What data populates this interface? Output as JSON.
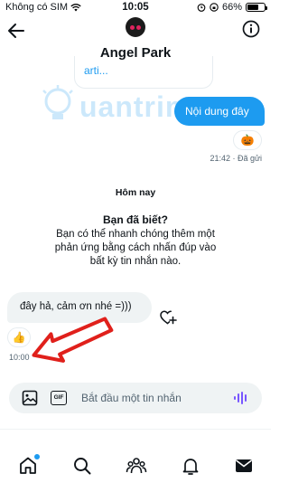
{
  "status_bar": {
    "carrier": "Không có SIM",
    "time": "10:05",
    "battery": "66%",
    "battery_level": 0.66
  },
  "header": {
    "title": "Angel Park"
  },
  "messages": {
    "quoted_link": "arti...",
    "outgoing_text": "Nội dung đây",
    "outgoing_reaction": "🎃",
    "outgoing_meta": "21:42 · Đã gửi",
    "day_label": "Hôm nay",
    "tip_title": "Bạn đã biết?",
    "tip_body": "Bạn có thể nhanh chóng thêm một phản ứng bằng cách nhấn đúp vào bất kỳ tin nhắn nào.",
    "incoming_text": "đây hả, cảm ơn nhé =)))",
    "incoming_reaction": "👍",
    "incoming_time": "10:00"
  },
  "composer": {
    "placeholder": "Bắt đầu một tin nhắn",
    "gif_label": "GIF"
  },
  "watermark": {
    "text": "uantrimang"
  },
  "colors": {
    "accent": "#1d9bf0",
    "bubble_in": "#eff3f4",
    "arrow": "#e0201b",
    "text_secondary": "#536471"
  }
}
